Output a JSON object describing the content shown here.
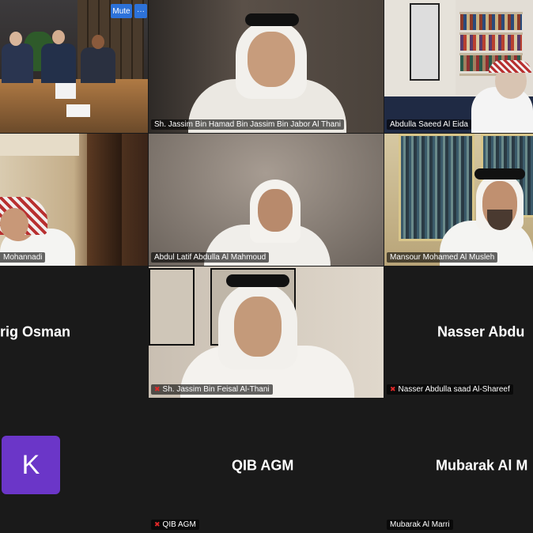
{
  "controls": {
    "mute_label": "Mute",
    "more_label": "···"
  },
  "tiles": [
    {
      "label": ""
    },
    {
      "label": "Sh. Jassim Bin Hamad Bin Jassim Bin Jabor Al Thani"
    },
    {
      "label": "Abdulla Saeed Al Eida"
    },
    {
      "label": "Mohannadi"
    },
    {
      "label": "Abdul Latif Abdulla Al Mahmoud"
    },
    {
      "label": "Mansour Mohamed Al Musleh"
    },
    {
      "bigname": "rig Osman"
    },
    {
      "label": "Sh. Jassim Bin Feisal Al-Thani"
    },
    {
      "bigname": "Nasser  Abdu",
      "label": "Nasser Abdulla saad Al-Shareef"
    },
    {
      "avatar_letter": "K"
    },
    {
      "bigname": "QIB AGM",
      "label": "QIB AGM"
    },
    {
      "bigname": "Mubarak Al M",
      "label": "Mubarak Al Marri"
    }
  ],
  "colors": {
    "active_border": "#2fbf4e",
    "avatar_bg": "#6b36c8",
    "mute_red": "#e02828"
  }
}
